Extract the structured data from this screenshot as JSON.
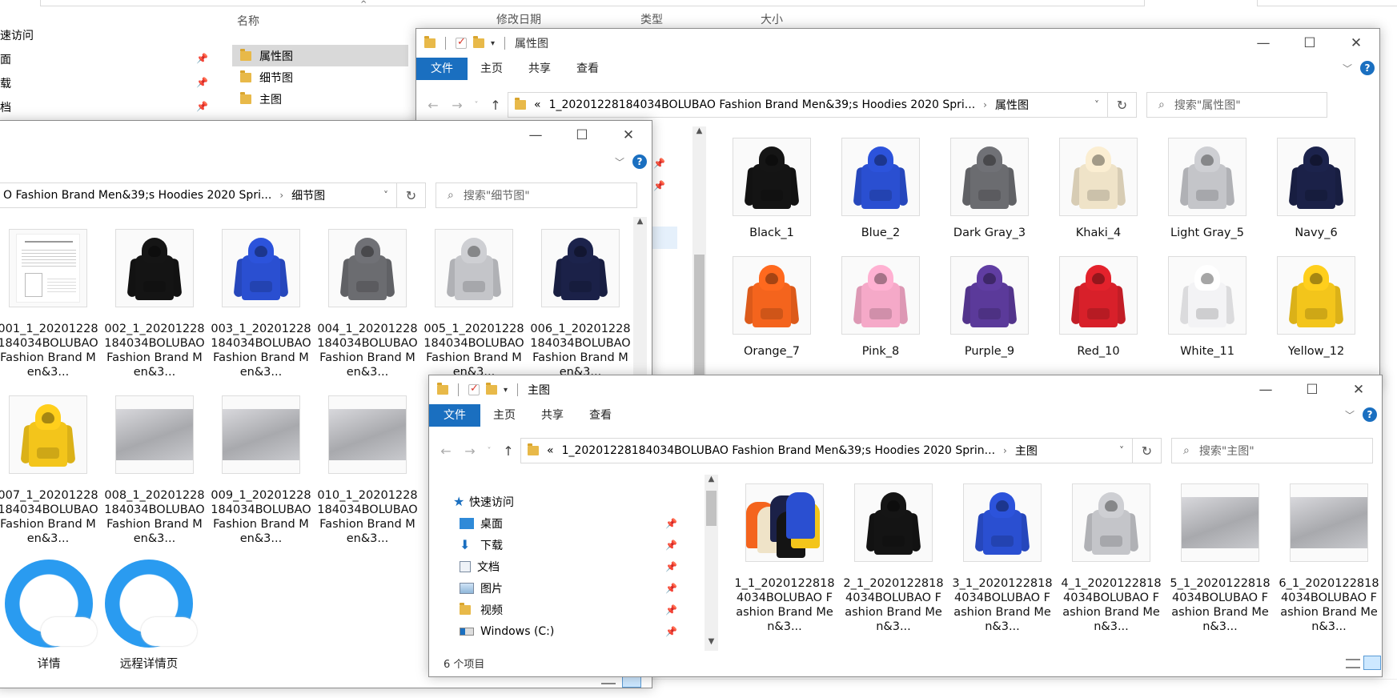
{
  "back_window": {
    "col_name": "名称",
    "col_modified": "修改日期",
    "col_type": "类型",
    "col_size": "大小",
    "nav": [
      {
        "label": "速访问"
      },
      {
        "label": "面"
      },
      {
        "label": "载"
      },
      {
        "label": "档"
      }
    ],
    "files": [
      {
        "label": "属性图"
      },
      {
        "label": "细节图"
      },
      {
        "label": "主图"
      }
    ]
  },
  "attr_window": {
    "title": "属性图",
    "tabs": {
      "file": "文件",
      "home": "主页",
      "share": "共享",
      "view": "查看"
    },
    "address": "1_20201228184034BOLUBAO Fashion Brand Men&39;s Hoodies 2020 Spri...",
    "address_current": "属性图",
    "search_placeholder": "搜索\"属性图\"",
    "items": [
      {
        "label": "Black_1",
        "color": "#141414"
      },
      {
        "label": "Blue_2",
        "color": "#2a4fd1"
      },
      {
        "label": "Dark Gray_3",
        "color": "#6b6c70"
      },
      {
        "label": "Khaki_4",
        "color": "#efe3c8"
      },
      {
        "label": "Light Gray_5",
        "color": "#c4c5c9"
      },
      {
        "label": "Navy_6",
        "color": "#1b2148"
      },
      {
        "label": "Orange_7",
        "color": "#f4641d"
      },
      {
        "label": "Pink_8",
        "color": "#f5a9c8"
      },
      {
        "label": "Purple_9",
        "color": "#5b3a9a"
      },
      {
        "label": "Red_10",
        "color": "#d8202a"
      },
      {
        "label": "White_11",
        "color": "#f3f3f5"
      },
      {
        "label": "Yellow_12",
        "color": "#f3c51b"
      }
    ]
  },
  "detail_window": {
    "address": "O Fashion Brand Men&39;s Hoodies 2020 Spri...",
    "address_current": "细节图",
    "search_placeholder": "搜索\"细节图\"",
    "items": [
      {
        "label": "001_1_20201228184034BOLUBAO Fashion Brand Men&3...",
        "color": "chart"
      },
      {
        "label": "002_1_20201228184034BOLUBAO Fashion Brand Men&3...",
        "color": "#141414"
      },
      {
        "label": "003_1_20201228184034BOLUBAO Fashion Brand Men&3...",
        "color": "#2a4fd1"
      },
      {
        "label": "004_1_20201228184034BOLUBAO Fashion Brand Men&3...",
        "color": "#6b6c70"
      },
      {
        "label": "005_1_20201228184034BOLUBAO Fashion Brand Men&3...",
        "color": "#c4c5c9"
      },
      {
        "label": "006_1_20201228184034BOLUBAO Fashion Brand Men&3...",
        "color": "#1b2148"
      },
      {
        "label": "007_1_20201228184034BOLUBAO Fashion Brand Men&3...",
        "color": "#f3c51b"
      },
      {
        "label": "008_1_20201228184034BOLUBAO Fashion Brand Men&3...",
        "color": "closeup"
      },
      {
        "label": "009_1_20201228184034BOLUBAO Fashion Brand Men&3...",
        "color": "closeup"
      },
      {
        "label": "010_1_20201228184034BOLUBAO Fashion Brand Men&3...",
        "color": "closeup"
      }
    ],
    "shortcuts": [
      {
        "label": "详情"
      },
      {
        "label": "远程详情页"
      }
    ]
  },
  "main_window": {
    "title": "主图",
    "tabs": {
      "file": "文件",
      "home": "主页",
      "share": "共享",
      "view": "查看"
    },
    "address": "1_20201228184034BOLUBAO Fashion Brand Men&39;s Hoodies 2020 Sprin...",
    "address_current": "主图",
    "search_placeholder": "搜索\"主图\"",
    "nav": [
      {
        "label": "快速访问"
      },
      {
        "label": "桌面"
      },
      {
        "label": "下载"
      },
      {
        "label": "文档"
      },
      {
        "label": "图片"
      },
      {
        "label": "视频"
      },
      {
        "label": "Windows (C:)"
      }
    ],
    "items": [
      {
        "label": "1_1_20201228184034BOLUBAO Fashion Brand Men&3...",
        "color": "group"
      },
      {
        "label": "2_1_20201228184034BOLUBAO Fashion Brand Men&3...",
        "color": "#141414"
      },
      {
        "label": "3_1_20201228184034BOLUBAO Fashion Brand Men&3...",
        "color": "#2a4fd1"
      },
      {
        "label": "4_1_20201228184034BOLUBAO Fashion Brand Men&3...",
        "color": "#c4c5c9"
      },
      {
        "label": "5_1_20201228184034BOLUBAO Fashion Brand Men&3...",
        "color": "closeup"
      },
      {
        "label": "6_1_20201228184034BOLUBAO Fashion Brand Men&3...",
        "color": "closeup"
      }
    ],
    "status": "6 个项目"
  }
}
